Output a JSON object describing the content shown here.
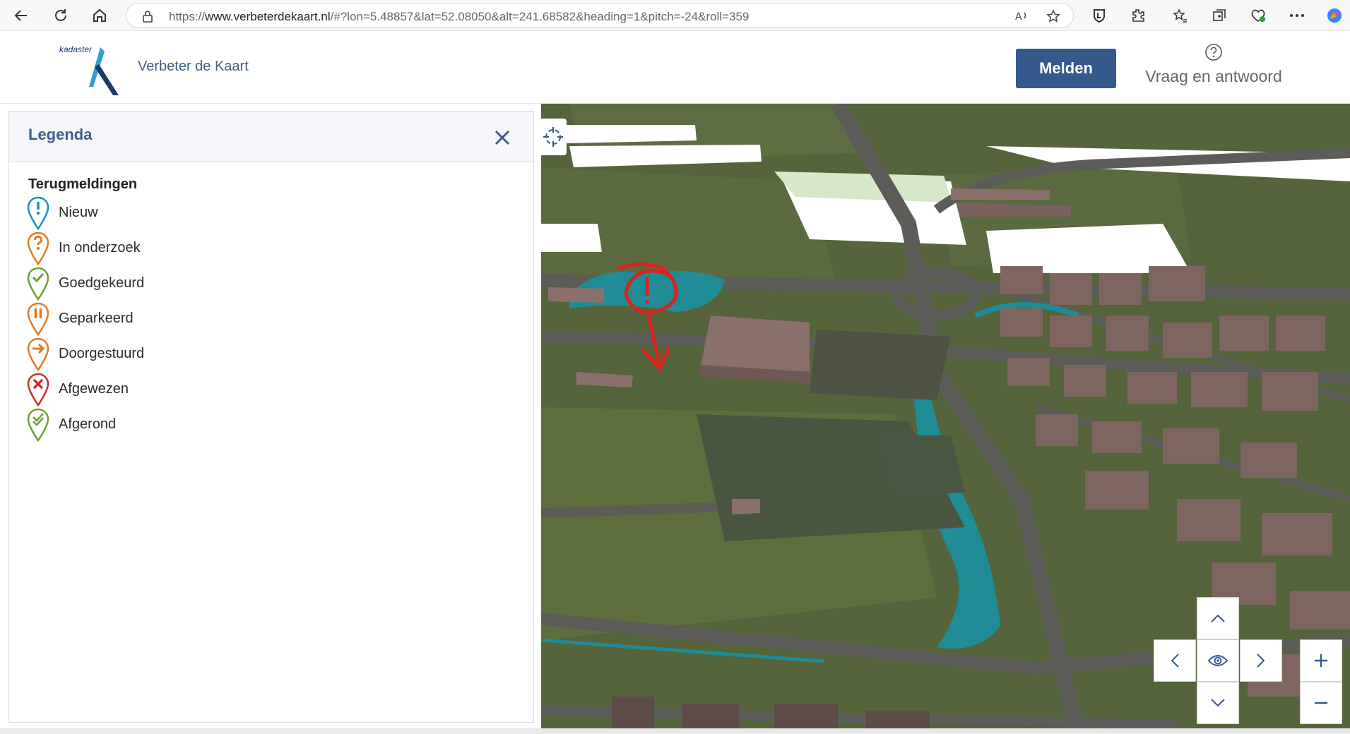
{
  "browser": {
    "url_prefix": "https://",
    "url_domain": "www.verbeterdekaart.nl",
    "url_rest": "/#?lon=5.48857&lat=52.08050&alt=241.68582&heading=1&pitch=-24&roll=359"
  },
  "header": {
    "brand_small": "kadaster",
    "app_title": "Verbeter de Kaart",
    "melden_label": "Melden",
    "faq_label": "Vraag en antwoord"
  },
  "legend": {
    "title": "Legenda",
    "section_title": "Terugmeldingen",
    "items": [
      {
        "label": "Nieuw",
        "icon": "exclamation-pin-icon",
        "color": "#1a8fc4"
      },
      {
        "label": "In onderzoek",
        "icon": "question-pin-icon",
        "color": "#e07a1f"
      },
      {
        "label": "Goedgekeurd",
        "icon": "check-pin-icon",
        "color": "#6aa130"
      },
      {
        "label": "Geparkeerd",
        "icon": "pause-pin-icon",
        "color": "#e07a1f"
      },
      {
        "label": "Doorgestuurd",
        "icon": "arrow-pin-icon",
        "color": "#e07a1f"
      },
      {
        "label": "Afgewezen",
        "icon": "cross-pin-icon",
        "color": "#c9302c"
      },
      {
        "label": "Afgerond",
        "icon": "double-check-pin-icon",
        "color": "#6aa130"
      }
    ]
  },
  "colors": {
    "primary": "#34598d",
    "title_blue": "#3f5d8b",
    "map_grass": "#55643a",
    "building": "#8a6f6a",
    "water": "#1f8c96",
    "annotation": "#e0211e"
  }
}
